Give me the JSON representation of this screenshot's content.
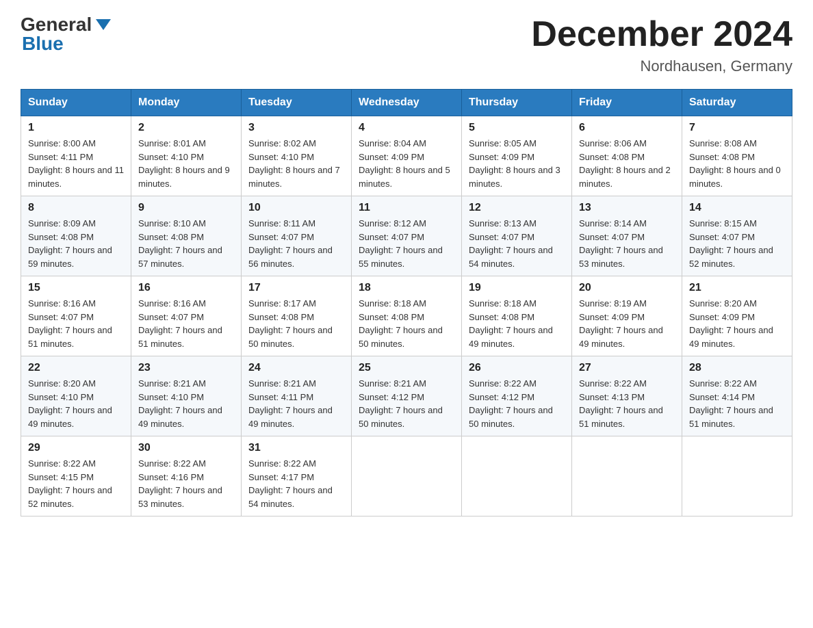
{
  "header": {
    "logo": {
      "general": "General",
      "blue": "Blue"
    },
    "month_title": "December 2024",
    "location": "Nordhausen, Germany"
  },
  "days_of_week": [
    "Sunday",
    "Monday",
    "Tuesday",
    "Wednesday",
    "Thursday",
    "Friday",
    "Saturday"
  ],
  "weeks": [
    [
      {
        "day": "1",
        "sunrise": "8:00 AM",
        "sunset": "4:11 PM",
        "daylight": "8 hours and 11 minutes."
      },
      {
        "day": "2",
        "sunrise": "8:01 AM",
        "sunset": "4:10 PM",
        "daylight": "8 hours and 9 minutes."
      },
      {
        "day": "3",
        "sunrise": "8:02 AM",
        "sunset": "4:10 PM",
        "daylight": "8 hours and 7 minutes."
      },
      {
        "day": "4",
        "sunrise": "8:04 AM",
        "sunset": "4:09 PM",
        "daylight": "8 hours and 5 minutes."
      },
      {
        "day": "5",
        "sunrise": "8:05 AM",
        "sunset": "4:09 PM",
        "daylight": "8 hours and 3 minutes."
      },
      {
        "day": "6",
        "sunrise": "8:06 AM",
        "sunset": "4:08 PM",
        "daylight": "8 hours and 2 minutes."
      },
      {
        "day": "7",
        "sunrise": "8:08 AM",
        "sunset": "4:08 PM",
        "daylight": "8 hours and 0 minutes."
      }
    ],
    [
      {
        "day": "8",
        "sunrise": "8:09 AM",
        "sunset": "4:08 PM",
        "daylight": "7 hours and 59 minutes."
      },
      {
        "day": "9",
        "sunrise": "8:10 AM",
        "sunset": "4:08 PM",
        "daylight": "7 hours and 57 minutes."
      },
      {
        "day": "10",
        "sunrise": "8:11 AM",
        "sunset": "4:07 PM",
        "daylight": "7 hours and 56 minutes."
      },
      {
        "day": "11",
        "sunrise": "8:12 AM",
        "sunset": "4:07 PM",
        "daylight": "7 hours and 55 minutes."
      },
      {
        "day": "12",
        "sunrise": "8:13 AM",
        "sunset": "4:07 PM",
        "daylight": "7 hours and 54 minutes."
      },
      {
        "day": "13",
        "sunrise": "8:14 AM",
        "sunset": "4:07 PM",
        "daylight": "7 hours and 53 minutes."
      },
      {
        "day": "14",
        "sunrise": "8:15 AM",
        "sunset": "4:07 PM",
        "daylight": "7 hours and 52 minutes."
      }
    ],
    [
      {
        "day": "15",
        "sunrise": "8:16 AM",
        "sunset": "4:07 PM",
        "daylight": "7 hours and 51 minutes."
      },
      {
        "day": "16",
        "sunrise": "8:16 AM",
        "sunset": "4:07 PM",
        "daylight": "7 hours and 51 minutes."
      },
      {
        "day": "17",
        "sunrise": "8:17 AM",
        "sunset": "4:08 PM",
        "daylight": "7 hours and 50 minutes."
      },
      {
        "day": "18",
        "sunrise": "8:18 AM",
        "sunset": "4:08 PM",
        "daylight": "7 hours and 50 minutes."
      },
      {
        "day": "19",
        "sunrise": "8:18 AM",
        "sunset": "4:08 PM",
        "daylight": "7 hours and 49 minutes."
      },
      {
        "day": "20",
        "sunrise": "8:19 AM",
        "sunset": "4:09 PM",
        "daylight": "7 hours and 49 minutes."
      },
      {
        "day": "21",
        "sunrise": "8:20 AM",
        "sunset": "4:09 PM",
        "daylight": "7 hours and 49 minutes."
      }
    ],
    [
      {
        "day": "22",
        "sunrise": "8:20 AM",
        "sunset": "4:10 PM",
        "daylight": "7 hours and 49 minutes."
      },
      {
        "day": "23",
        "sunrise": "8:21 AM",
        "sunset": "4:10 PM",
        "daylight": "7 hours and 49 minutes."
      },
      {
        "day": "24",
        "sunrise": "8:21 AM",
        "sunset": "4:11 PM",
        "daylight": "7 hours and 49 minutes."
      },
      {
        "day": "25",
        "sunrise": "8:21 AM",
        "sunset": "4:12 PM",
        "daylight": "7 hours and 50 minutes."
      },
      {
        "day": "26",
        "sunrise": "8:22 AM",
        "sunset": "4:12 PM",
        "daylight": "7 hours and 50 minutes."
      },
      {
        "day": "27",
        "sunrise": "8:22 AM",
        "sunset": "4:13 PM",
        "daylight": "7 hours and 51 minutes."
      },
      {
        "day": "28",
        "sunrise": "8:22 AM",
        "sunset": "4:14 PM",
        "daylight": "7 hours and 51 minutes."
      }
    ],
    [
      {
        "day": "29",
        "sunrise": "8:22 AM",
        "sunset": "4:15 PM",
        "daylight": "7 hours and 52 minutes."
      },
      {
        "day": "30",
        "sunrise": "8:22 AM",
        "sunset": "4:16 PM",
        "daylight": "7 hours and 53 minutes."
      },
      {
        "day": "31",
        "sunrise": "8:22 AM",
        "sunset": "4:17 PM",
        "daylight": "7 hours and 54 minutes."
      },
      null,
      null,
      null,
      null
    ]
  ],
  "labels": {
    "sunrise": "Sunrise:",
    "sunset": "Sunset:",
    "daylight": "Daylight:"
  }
}
